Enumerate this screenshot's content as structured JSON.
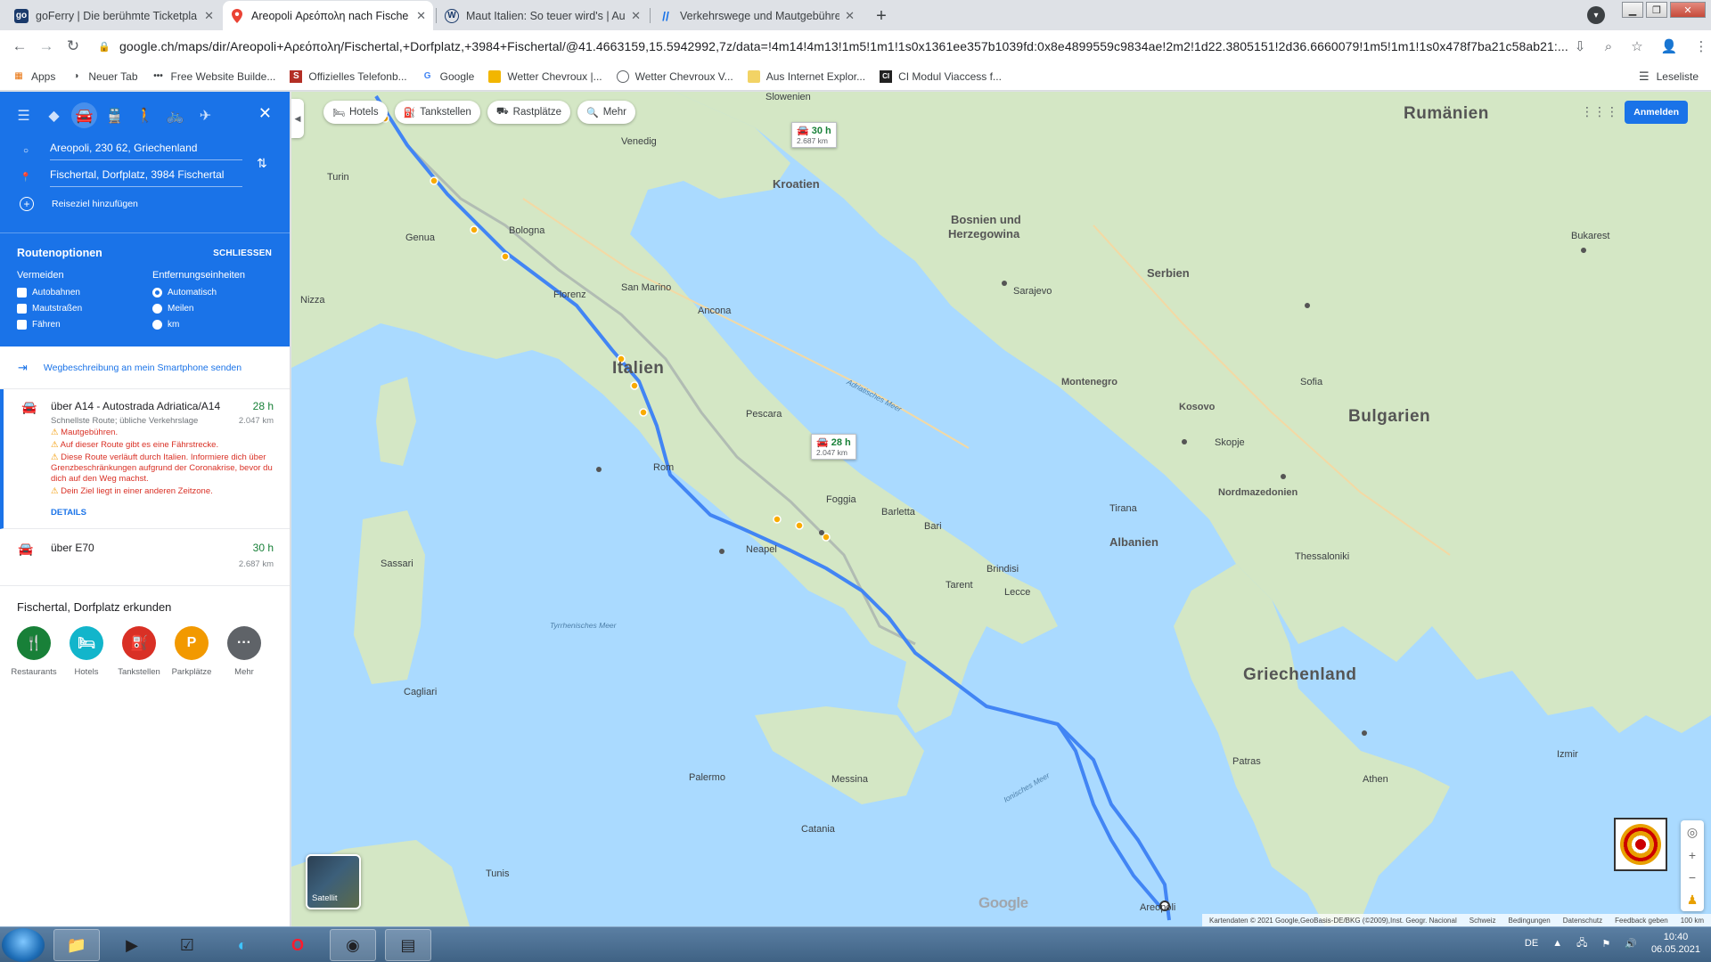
{
  "tabs": [
    {
      "title": "goFerry | Die berühmte Ticketpla",
      "icon": "goferry-icon",
      "active": false
    },
    {
      "title": "Areopoli Αρεόπολη nach Fische",
      "icon": "maps-pin-icon",
      "active": true
    },
    {
      "title": "Maut Italien: So teuer wird's | Au",
      "icon": "w-icon",
      "active": false
    },
    {
      "title": "Verkehrswege und Mautgebühre",
      "icon": "slash-icon",
      "active": false
    }
  ],
  "tab_close": "✕",
  "new_tab": "+",
  "address": {
    "url": "google.ch/maps/dir/Areopoli+Αρεόπολη/Fischertal,+Dorfplatz,+3984+Fischertal/@41.4663159,15.5942992,7z/data=!4m14!4m13!1m5!1m1!1s0x1361ee357b1039fd:0x8e4899559c9834ae!2m2!1d22.3805151!2d36.6660079!1m5!1m1!1s0x478f7ba21c58ab21:..."
  },
  "bookmarks": [
    {
      "label": "Apps",
      "icon": "apps-grid-icon"
    },
    {
      "label": "Neuer Tab",
      "icon": "globe-icon"
    },
    {
      "label": "Free Website Builde...",
      "icon": "dots-icon"
    },
    {
      "label": "Offizielles Telefonb...",
      "icon": "s-icon"
    },
    {
      "label": "Google",
      "icon": "google-icon"
    },
    {
      "label": "Wetter Chevroux |...",
      "icon": "folder-icon"
    },
    {
      "label": "Wetter Chevroux V...",
      "icon": "globe-icon"
    },
    {
      "label": "Aus Internet Explor...",
      "icon": "folder-icon"
    },
    {
      "label": "CI Modul Viaccess f...",
      "icon": "ci-icon"
    }
  ],
  "reading_list": "Leseliste",
  "panel": {
    "origin": "Areopoli, 230 62, Griechenland",
    "destination": "Fischertal, Dorfplatz, 3984 Fischertal",
    "add_destination": "Reiseziel hinzufügen",
    "route_options": {
      "title": "Routenoptionen",
      "close": "SCHLIESSEN",
      "avoid_title": "Vermeiden",
      "avoid": [
        "Autobahnen",
        "Mautstraßen",
        "Fähren"
      ],
      "units_title": "Entfernungseinheiten",
      "units": [
        "Automatisch",
        "Meilen",
        "km"
      ],
      "units_selected": "Automatisch"
    },
    "send_to_phone": "Wegbeschreibung an mein Smartphone senden",
    "routes": [
      {
        "name": "über A14 - Autostrada Adriatica/A14",
        "time": "28 h",
        "distance": "2.047 km",
        "subtitle": "Schnellste Route; übliche Verkehrslage",
        "warnings": [
          "Mautgebühren.",
          "Auf dieser Route gibt es eine Fährstrecke.",
          "Diese Route verläuft durch Italien. Informiere dich über Grenzbeschränkungen aufgrund der Coronakrise, bevor du dich auf den Weg machst.",
          "Dein Ziel liegt in einer anderen Zeitzone."
        ],
        "details": "DETAILS"
      },
      {
        "name": "über E70",
        "time": "30 h",
        "distance": "2.687 km"
      }
    ],
    "explore_title": "Fischertal, Dorfplatz erkunden",
    "explore": [
      {
        "label": "Restaurants",
        "color": "#188038",
        "icon": "fork-knife-icon",
        "glyph": "🍴"
      },
      {
        "label": "Hotels",
        "color": "#12b5cb",
        "icon": "bed-icon",
        "glyph": "🛏"
      },
      {
        "label": "Tankstellen",
        "color": "#d93025",
        "icon": "fuel-icon",
        "glyph": "⛽"
      },
      {
        "label": "Parkplätze",
        "color": "#f29900",
        "icon": "parking-icon",
        "glyph": "P"
      },
      {
        "label": "Mehr",
        "color": "#5f6368",
        "icon": "more-icon",
        "glyph": "···"
      }
    ]
  },
  "map": {
    "chips": [
      {
        "label": "Hotels",
        "icon": "bed-icon"
      },
      {
        "label": "Tankstellen",
        "icon": "fuel-icon"
      },
      {
        "label": "Rastplätze",
        "icon": "rest-area-icon"
      },
      {
        "label": "Mehr",
        "icon": "search-icon"
      }
    ],
    "sign_in": "Anmelden",
    "callouts": [
      {
        "time": "30 h",
        "distance": "2.687 km"
      },
      {
        "time": "28 h",
        "distance": "2.047 km"
      }
    ],
    "countries": [
      "Rumänien",
      "Kroatien",
      "Bosnien und",
      "Herzegowina",
      "Serbien",
      "Italien",
      "Montenegro",
      "Kosovo",
      "Bulgarien",
      "Nordmazedonien",
      "Albanien",
      "Griechenland"
    ],
    "cities": [
      "Slowenien",
      "Venedig",
      "Turin",
      "Genua",
      "Nizza",
      "Bologna",
      "San Marino",
      "Florenz",
      "Sarajevo",
      "Bukarest",
      "Rom",
      "Neapel",
      "Bari",
      "Foggia",
      "Pescara",
      "Barletta",
      "Tarent",
      "Brindisi",
      "Lecce",
      "Sofia",
      "Skopje",
      "Tirana",
      "Thessaloniki",
      "Athen",
      "Patras",
      "Palermo",
      "Catania",
      "Messina",
      "Tunis",
      "Izmir",
      "Areopoli",
      "Sassari",
      "Cagliari",
      "Ancona"
    ],
    "seas": [
      "Adriatisches Meer",
      "Tyrrhenisches Meer",
      "Ionisches Meer"
    ],
    "satellite": "Satellit",
    "google_logo": "Google",
    "footer": [
      "Kartendaten © 2021 Google,GeoBasis-DE/BKG (©2009),Inst. Geogr. Nacional",
      "Schweiz",
      "Bedingungen",
      "Datenschutz",
      "Feedback geben",
      "100 km"
    ]
  },
  "taskbar": {
    "apps": [
      "explorer-icon",
      "media-player-icon",
      "tasks-icon",
      "edge-icon",
      "opera-icon",
      "chrome-icon",
      "notepad-icon"
    ],
    "lang": "DE",
    "time": "10:40",
    "date": "06.05.2021"
  },
  "colors": {
    "accent": "#1a73e8",
    "route": "#4285f4",
    "land": "#d9ead2",
    "sea": "#aadaff"
  }
}
